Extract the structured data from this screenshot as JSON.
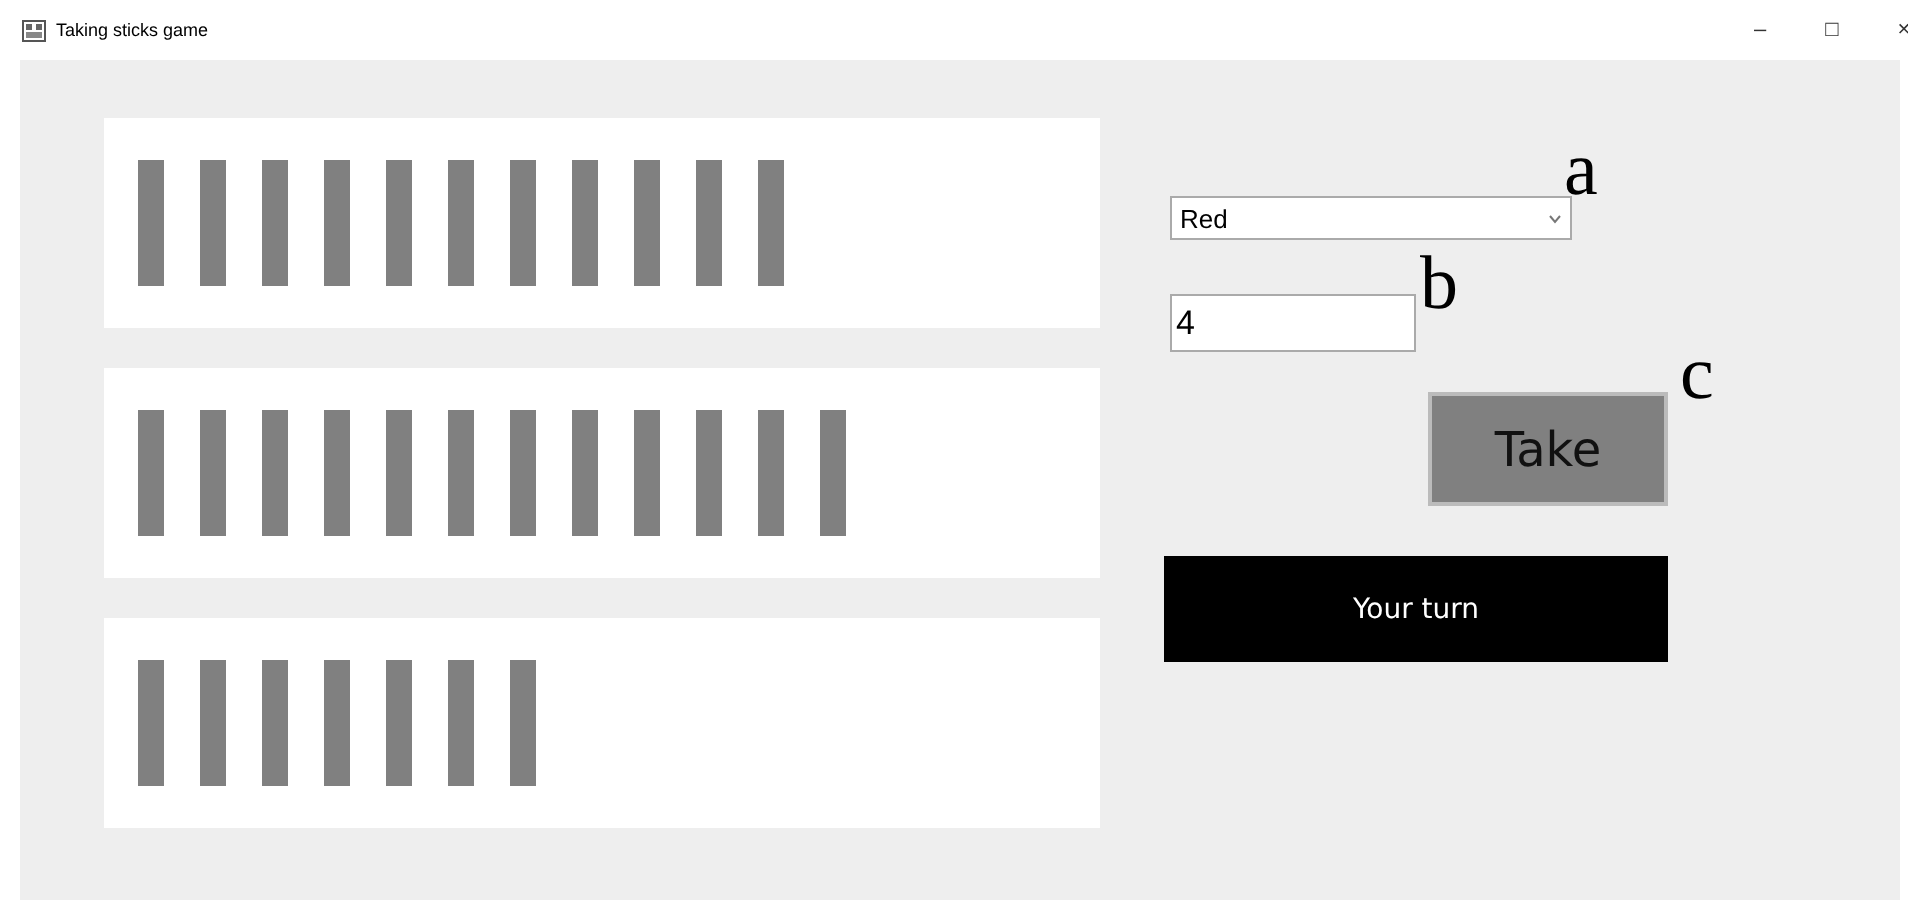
{
  "window": {
    "title": "Taking sticks game",
    "controls": [
      "–",
      "□",
      "×"
    ]
  },
  "piles": [
    {
      "sticks": [
        {
          "kind": "stick"
        },
        {
          "kind": "stick"
        },
        {
          "kind": "stick"
        },
        {
          "kind": "stick"
        },
        {
          "kind": "stick"
        },
        {
          "kind": "stick"
        },
        {
          "kind": "stick"
        },
        {
          "kind": "stick"
        },
        {
          "kind": "stick"
        },
        {
          "kind": "stick"
        },
        {
          "kind": "stick"
        }
      ]
    },
    {
      "sticks": [
        {
          "kind": "stick"
        },
        {
          "kind": "stick"
        },
        {
          "kind": "stick"
        },
        {
          "kind": "stick"
        },
        {
          "kind": "stick"
        },
        {
          "kind": "stick"
        },
        {
          "kind": "stick"
        },
        {
          "kind": "stick"
        },
        {
          "kind": "stick"
        },
        {
          "kind": "stick"
        },
        {
          "kind": "stick"
        },
        {
          "kind": "stick"
        }
      ]
    },
    {
      "sticks": [
        {
          "kind": "stick"
        },
        {
          "kind": "stick"
        },
        {
          "kind": "stick"
        },
        {
          "kind": "stick"
        },
        {
          "kind": "stick"
        },
        {
          "kind": "stick"
        },
        {
          "kind": "stick"
        }
      ]
    }
  ],
  "color_select": {
    "value": "Red",
    "annotation": "a"
  },
  "count_field": {
    "value": "4",
    "annotation": "b"
  },
  "take_button": {
    "label": "Take",
    "annotation": "c"
  },
  "status": {
    "text": "Your turn"
  }
}
